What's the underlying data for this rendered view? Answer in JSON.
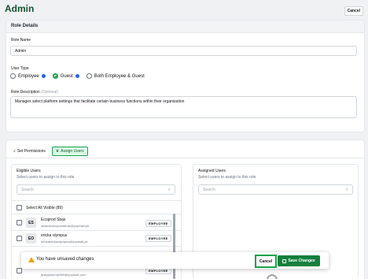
{
  "header": {
    "title": "Admin",
    "cancel_label": "Cancel"
  },
  "role_details": {
    "heading": "Role Details",
    "role_name_label": "Role Name",
    "role_name_value": "Admin",
    "user_type_label": "User Type",
    "user_type_options": [
      "Employee",
      "Guest",
      "Both Employee & Guest"
    ],
    "user_type_selected": "Guest",
    "description_label": "Role Description",
    "description_optional": "(Optional)",
    "description_value": "Manages select platform settings that facilitate certain business functions within their organization"
  },
  "tabs": [
    {
      "label": "Set Permissions",
      "icon": "key-icon",
      "active": false
    },
    {
      "label": "Assign Users",
      "icon": "users-icon",
      "active": true
    }
  ],
  "eligible": {
    "title": "Eligible Users",
    "subtitle": "Select users to assign to this role",
    "search_placeholder": "Search",
    "select_all_label": "Select All Visible (89)",
    "users": [
      {
        "initials": "ES",
        "name": "Ecoprod Sbas",
        "email": "sbasnevecoprodsbas@yopmail.ph",
        "badge": "EMPLOYEE"
      },
      {
        "initials": "EO",
        "name": "ericka olympus",
        "email": "erickaerickaolympus@yopmail.ph",
        "badge": "EMPLOYEE"
      },
      {
        "initials": "",
        "name": "",
        "email": "queyqinum@9eh@yopmail.com",
        "badge": "EMPLOYEE"
      }
    ]
  },
  "assigned": {
    "title": "Assigned Users",
    "subtitle": "Select users to assign to this role",
    "search_placeholder": "Search"
  },
  "toast": {
    "message": "You have unsaved changes",
    "cancel_label": "Cancel",
    "save_label": "Save Changes"
  },
  "colors": {
    "accent": "#15803d",
    "title": "#14532d",
    "info": "#2563eb",
    "warning": "#f59e0b"
  }
}
